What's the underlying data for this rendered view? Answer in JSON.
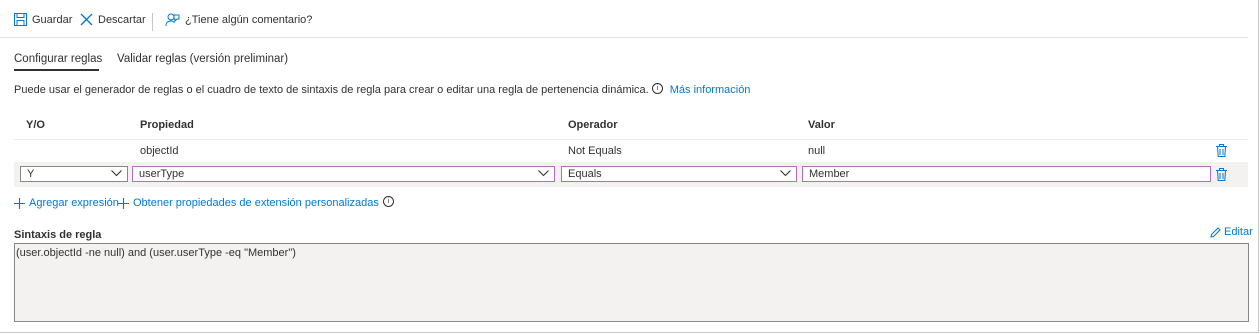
{
  "toolbar": {
    "save_label": "Guardar",
    "discard_label": "Descartar",
    "feedback_label": "¿Tiene algún comentario?"
  },
  "tabs": [
    {
      "label": "Configurar reglas",
      "active": true
    },
    {
      "label": "Validar reglas (versión preliminar)",
      "active": false
    }
  ],
  "info": {
    "text": "Puede usar el generador de reglas o el cuadro de texto de sintaxis de regla para crear o editar una regla de pertenencia dinámica.",
    "link": "Más información"
  },
  "table": {
    "headers": [
      "Y/O",
      "Propiedad",
      "Operador",
      "Valor"
    ],
    "row1": {
      "property": "objectId",
      "operator": "Not Equals",
      "value": "null"
    },
    "row2": {
      "andor": "Y",
      "property": "userType",
      "operator": "Equals",
      "value": "Member"
    }
  },
  "actions": {
    "add_expression": "Agregar expresión",
    "get_ext_props": "Obtener propiedades de extensión personalizadas"
  },
  "syntax": {
    "title": "Sintaxis de regla",
    "edit_label": "Editar",
    "text": "(user.objectId -ne null) and (user.userType -eq \"Member\")"
  },
  "colors": {
    "accent": "#0078d4",
    "focus_border": "#b36fb8"
  }
}
